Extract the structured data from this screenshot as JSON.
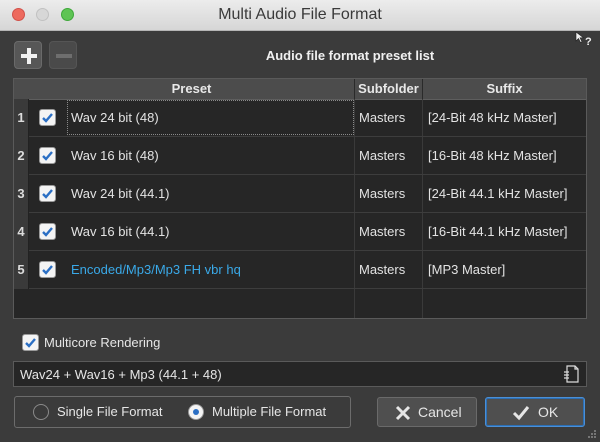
{
  "window": {
    "title": "Multi Audio File Format"
  },
  "toolbar": {
    "list_caption": "Audio file format preset list",
    "add_icon": "plus-icon",
    "remove_icon": "minus-icon",
    "help_icon": "whats-this-help-icon"
  },
  "table": {
    "columns": [
      "Preset",
      "Subfolder",
      "Suffix"
    ],
    "rows": [
      {
        "num": "1",
        "checked": true,
        "preset": "Wav 24 bit (48)",
        "subfolder": "Masters",
        "suffix": "[24-Bit 48 kHz Master]"
      },
      {
        "num": "2",
        "checked": true,
        "preset": "Wav 16 bit (48)",
        "subfolder": "Masters",
        "suffix": "[16-Bit 48 kHz Master]"
      },
      {
        "num": "3",
        "checked": true,
        "preset": "Wav 24 bit (44.1)",
        "subfolder": "Masters",
        "suffix": "[24-Bit 44.1 kHz Master]"
      },
      {
        "num": "4",
        "checked": true,
        "preset": "Wav 16 bit (44.1)",
        "subfolder": "Masters",
        "suffix": "[16-Bit 44.1 kHz Master]"
      },
      {
        "num": "5",
        "checked": true,
        "preset": "Encoded/Mp3/Mp3 FH vbr hq",
        "subfolder": "Masters",
        "suffix": "[MP3 Master]"
      }
    ]
  },
  "options": {
    "multicore_label": "Multicore Rendering",
    "multicore_checked": true
  },
  "summary": {
    "value": "Wav24 + Wav16 + Mp3 (44.1 + 48)"
  },
  "format_mode": {
    "single_label": "Single File Format",
    "multiple_label": "Multiple File Format",
    "selected": "multiple"
  },
  "buttons": {
    "cancel_label": "Cancel",
    "ok_label": "OK"
  },
  "colors": {
    "accent": "#2b6fc4",
    "encoded_preset": "#3aa9e8",
    "background": "#3b3b3b"
  }
}
